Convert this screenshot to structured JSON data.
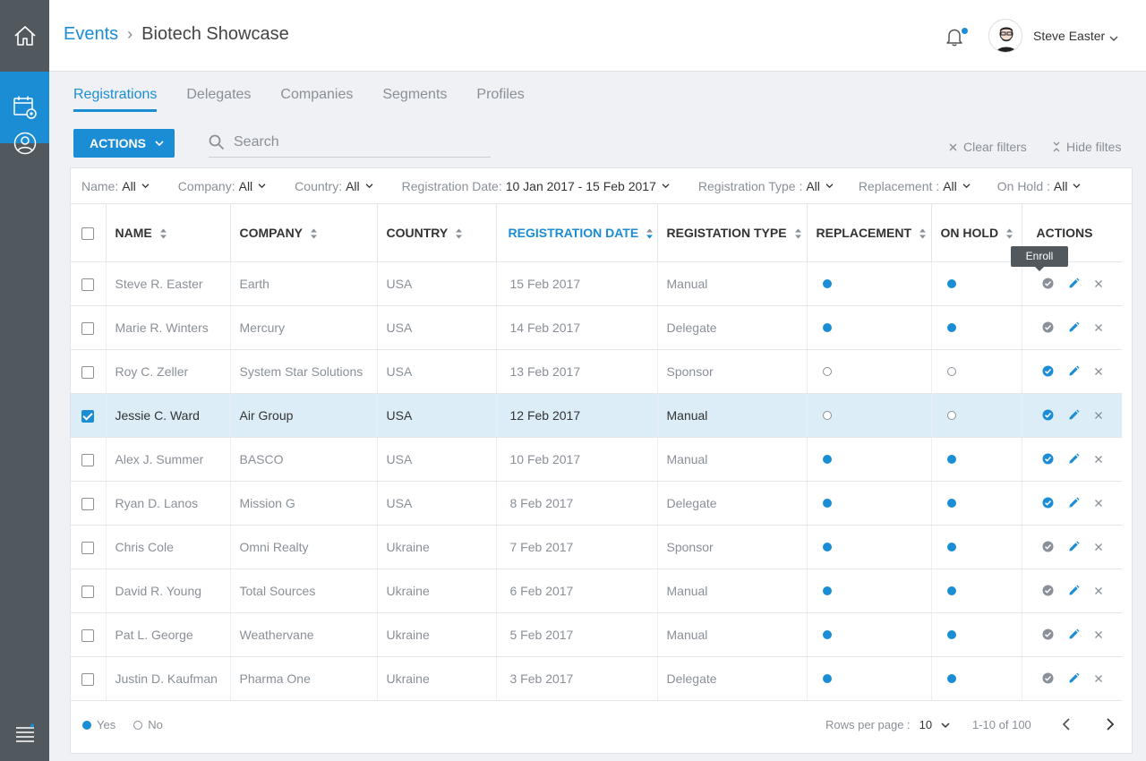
{
  "header": {
    "breadcrumb_root": "Events",
    "breadcrumb_sep": "›",
    "breadcrumb_current": "Biotech Showcase",
    "user_name": "Steve Easter"
  },
  "tabs": [
    {
      "label": "Registrations",
      "active": true
    },
    {
      "label": "Delegates"
    },
    {
      "label": "Companies"
    },
    {
      "label": "Segments"
    },
    {
      "label": "Profiles"
    }
  ],
  "toolbar": {
    "actions_label": "ACTIONS",
    "search_placeholder": "Search",
    "clear_filters": "Clear filters",
    "hide_filters": "Hide filtes"
  },
  "filters": [
    {
      "label": "Name:",
      "value": "All"
    },
    {
      "label": "Company:",
      "value": "All"
    },
    {
      "label": "Country:",
      "value": "All"
    },
    {
      "label": "Registration Date:",
      "value": "10 Jan 2017 - 15 Feb 2017"
    },
    {
      "label": "Registration Type :",
      "value": "All"
    },
    {
      "label": "Replacement :",
      "value": "All"
    },
    {
      "label": "On Hold :",
      "value": "All"
    }
  ],
  "columns": [
    "NAME",
    "COMPANY",
    "COUNTRY",
    "REGISTRATION DATE",
    "REGISTATION TYPE",
    "REPLACEMENT",
    "ON HOLD",
    "ACTIONS"
  ],
  "rows": [
    {
      "name": "Steve R. Easter",
      "company": "Earth",
      "country": "USA",
      "date": "15 Feb 2017",
      "type": "Manual",
      "replacement": true,
      "on_hold": true,
      "enrolled": false,
      "selected": false
    },
    {
      "name": "Marie R. Winters",
      "company": "Mercury",
      "country": "USA",
      "date": "14 Feb 2017",
      "type": "Delegate",
      "replacement": true,
      "on_hold": true,
      "enrolled": false,
      "selected": false
    },
    {
      "name": "Roy C. Zeller",
      "company": "System Star Solutions",
      "country": "USA",
      "date": "13 Feb 2017",
      "type": "Sponsor",
      "replacement": false,
      "on_hold": false,
      "enrolled": true,
      "selected": false
    },
    {
      "name": "Jessie C. Ward",
      "company": "Air Group",
      "country": "USA",
      "date": "12 Feb 2017",
      "type": "Manual",
      "replacement": false,
      "on_hold": false,
      "enrolled": true,
      "selected": true
    },
    {
      "name": "Alex J. Summer",
      "company": "BASCO",
      "country": "USA",
      "date": "10 Feb 2017",
      "type": "Manual",
      "replacement": true,
      "on_hold": true,
      "enrolled": true,
      "selected": false
    },
    {
      "name": "Ryan D. Lanos",
      "company": "Mission G",
      "country": "USA",
      "date": "8 Feb 2017",
      "type": "Delegate",
      "replacement": true,
      "on_hold": true,
      "enrolled": true,
      "selected": false
    },
    {
      "name": "Chris Cole",
      "company": "Omni Realty",
      "country": "Ukraine",
      "date": "7 Feb 2017",
      "type": "Sponsor",
      "replacement": true,
      "on_hold": true,
      "enrolled": false,
      "selected": false
    },
    {
      "name": "David R. Young",
      "company": "Total Sources",
      "country": "Ukraine",
      "date": "6 Feb 2017",
      "type": "Manual",
      "replacement": true,
      "on_hold": true,
      "enrolled": false,
      "selected": false
    },
    {
      "name": "Pat L. George",
      "company": "Weathervane",
      "country": "Ukraine",
      "date": "5  Feb 2017",
      "type": "Manual",
      "replacement": true,
      "on_hold": true,
      "enrolled": false,
      "selected": false
    },
    {
      "name": "Justin D. Kaufman",
      "company": "Pharma One",
      "country": "Ukraine",
      "date": "3 Feb 2017",
      "type": "Delegate",
      "replacement": true,
      "on_hold": true,
      "enrolled": false,
      "selected": false
    }
  ],
  "tooltip": "Enroll",
  "legend": {
    "yes": "Yes",
    "no": "No"
  },
  "pagination": {
    "rows_per_page_label": "Rows per page :",
    "rows_per_page_value": "10",
    "range": "1-10 of 100"
  },
  "colors": {
    "accent": "#1b8dd4",
    "sidebar": "#52595e",
    "muted": "#8a9098",
    "selected_row": "#dcedf7"
  },
  "icons": [
    "home-icon",
    "calendar-settings-icon",
    "user-circle-icon",
    "menu-icon",
    "bell-icon",
    "search-icon",
    "check-circle-icon",
    "edit-icon",
    "close-icon",
    "chevron-down-icon",
    "sort-icon",
    "chevron-left-icon",
    "chevron-right-icon"
  ]
}
